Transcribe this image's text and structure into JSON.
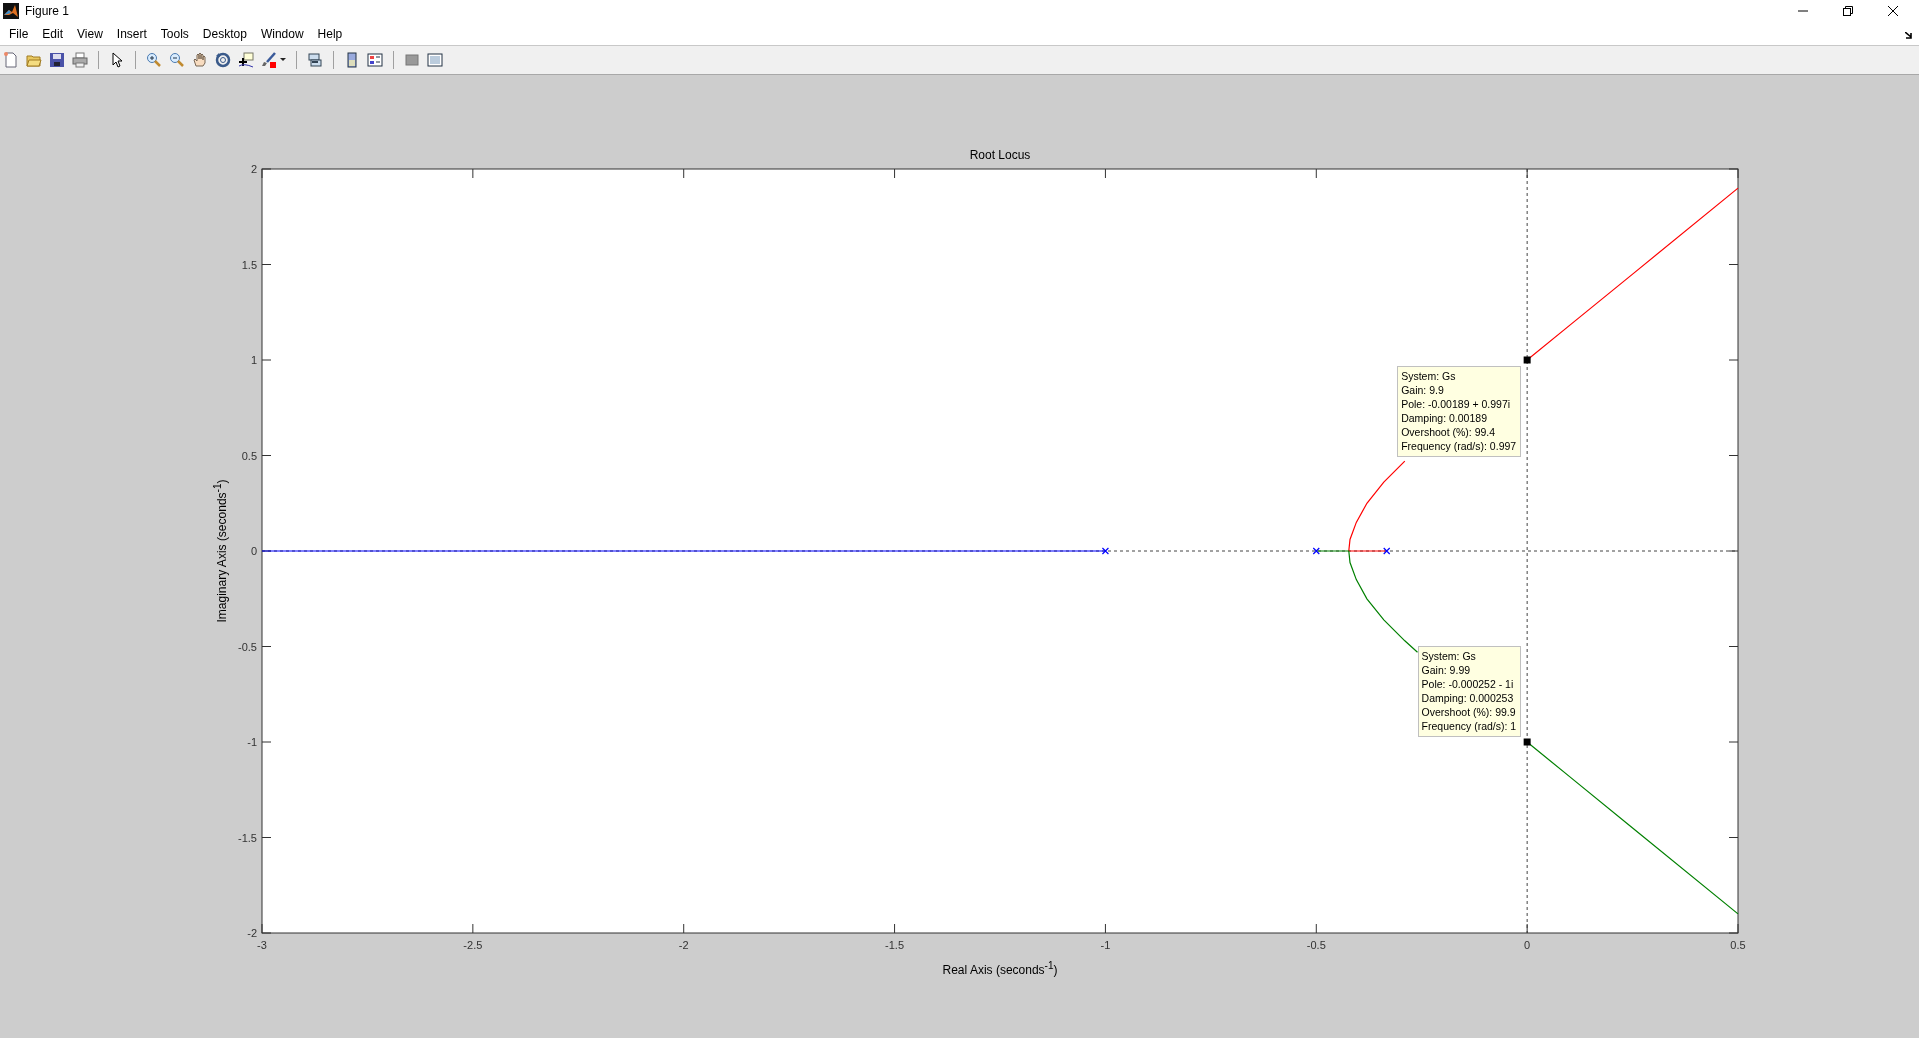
{
  "window": {
    "title": "Figure 1"
  },
  "menu": [
    "File",
    "Edit",
    "View",
    "Insert",
    "Tools",
    "Desktop",
    "Window",
    "Help"
  ],
  "chart_data": {
    "type": "line",
    "title": "Root Locus",
    "xlabel": "Real Axis (seconds$^{-1}$)",
    "ylabel": "Imaginary Axis (seconds$^{-1}$)",
    "xlim": [
      -3,
      0.5
    ],
    "ylim": [
      -2,
      2
    ],
    "xticks": [
      -3,
      -2.5,
      -2,
      -1.5,
      -1,
      -0.5,
      0,
      0.5
    ],
    "yticks": [
      -2,
      -1.5,
      -1,
      -0.5,
      0,
      0.5,
      1,
      1.5,
      2
    ],
    "series": [
      {
        "color": "#0000ff",
        "x": [
          -1,
          -3
        ],
        "values": [
          0,
          0
        ]
      },
      {
        "color": "#ff0000",
        "x": [
          -0.333,
          -0.423,
          -0.42,
          -0.405,
          -0.38,
          -0.34,
          -0.29
        ],
        "values": [
          0,
          0,
          0.06,
          0.15,
          0.25,
          0.36,
          0.47
        ]
      },
      {
        "color": "#ff0000",
        "x": [
          0,
          0.1,
          0.25,
          0.5
        ],
        "values": [
          1.0,
          1.18,
          1.45,
          1.9
        ]
      },
      {
        "color": "#008000",
        "x": [
          -0.5,
          -0.423,
          -0.42,
          -0.405,
          -0.38,
          -0.34,
          -0.29,
          -0.26
        ],
        "values": [
          0,
          0,
          -0.06,
          -0.15,
          -0.25,
          -0.36,
          -0.47,
          -0.53
        ]
      },
      {
        "color": "#008000",
        "x": [
          0,
          0.1,
          0.25,
          0.5
        ],
        "values": [
          -1.0,
          -1.18,
          -1.45,
          -1.9
        ]
      },
      {
        "type": "scatter",
        "marker": "x",
        "color": "#0000ff",
        "x": [
          -1,
          -0.5,
          -0.333
        ],
        "values": [
          0,
          0,
          0
        ]
      },
      {
        "type": "scatter",
        "marker": "square",
        "color": "#000000",
        "x": [
          0,
          0
        ],
        "values": [
          1,
          -1
        ]
      }
    ]
  },
  "datatips": [
    {
      "lines": [
        "System: Gs",
        "Gain: 9.9",
        "Pole: -0.00189 + 0.997i",
        "Damping: 0.00189",
        "Overshoot (%): 99.4",
        "Frequency (rad/s): 0.997"
      ]
    },
    {
      "lines": [
        "System: Gs",
        "Gain: 9.99",
        "Pole: -0.000252 - 1i",
        "Damping: 0.000253",
        "Overshoot (%): 99.9",
        "Frequency (rad/s): 1"
      ]
    }
  ]
}
